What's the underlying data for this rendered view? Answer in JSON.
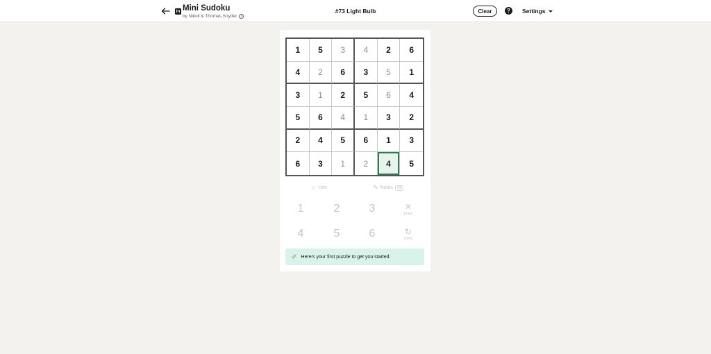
{
  "header": {
    "app_title": "Mini Sudoku",
    "byline": "by Nikoli & Thomas Snyder",
    "puzzle_title": "#73 Light Bulb",
    "clear_label": "Clear",
    "help_label": "?",
    "settings_label": "Settings"
  },
  "board": {
    "selected": {
      "row": 5,
      "col": 4
    },
    "rows": [
      [
        {
          "v": "1",
          "given": true
        },
        {
          "v": "5",
          "given": true
        },
        {
          "v": "3",
          "given": false
        },
        {
          "v": "4",
          "given": false
        },
        {
          "v": "2",
          "given": true
        },
        {
          "v": "6",
          "given": true
        }
      ],
      [
        {
          "v": "4",
          "given": true
        },
        {
          "v": "2",
          "given": false
        },
        {
          "v": "6",
          "given": true
        },
        {
          "v": "3",
          "given": true
        },
        {
          "v": "5",
          "given": false
        },
        {
          "v": "1",
          "given": true
        }
      ],
      [
        {
          "v": "3",
          "given": true
        },
        {
          "v": "1",
          "given": false
        },
        {
          "v": "2",
          "given": true
        },
        {
          "v": "5",
          "given": true
        },
        {
          "v": "6",
          "given": false
        },
        {
          "v": "4",
          "given": true
        }
      ],
      [
        {
          "v": "5",
          "given": true
        },
        {
          "v": "6",
          "given": true
        },
        {
          "v": "4",
          "given": false
        },
        {
          "v": "1",
          "given": false
        },
        {
          "v": "3",
          "given": true
        },
        {
          "v": "2",
          "given": true
        }
      ],
      [
        {
          "v": "2",
          "given": true
        },
        {
          "v": "4",
          "given": true
        },
        {
          "v": "5",
          "given": true
        },
        {
          "v": "6",
          "given": true
        },
        {
          "v": "1",
          "given": true
        },
        {
          "v": "3",
          "given": true
        }
      ],
      [
        {
          "v": "6",
          "given": true
        },
        {
          "v": "3",
          "given": true
        },
        {
          "v": "1",
          "given": false
        },
        {
          "v": "2",
          "given": false
        },
        {
          "v": "4",
          "given": true
        },
        {
          "v": "5",
          "given": true
        }
      ]
    ]
  },
  "tools": {
    "hint_label": "Hint",
    "notes_label": "Notes",
    "notes_state": "Off"
  },
  "keypad": {
    "numbers": [
      "1",
      "2",
      "3",
      "4",
      "5",
      "6"
    ],
    "erase_label": "Erase",
    "undo_label": "Undo"
  },
  "banner": {
    "text": "Here's your first puzzle to get you started."
  },
  "colors": {
    "selected_border": "#2f7a52",
    "selected_fill": "#e6f4ec",
    "banner_bg": "#d7f3ea",
    "page_bg": "#f3f2ef"
  }
}
